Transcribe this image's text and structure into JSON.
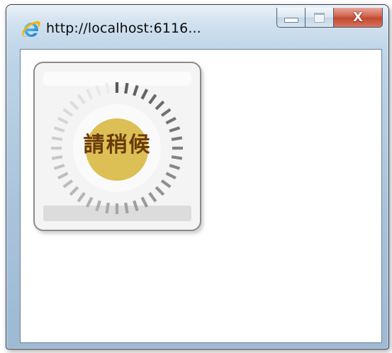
{
  "window": {
    "title": "http://localhost:6116...",
    "icon": "ie-icon",
    "close_glyph": "X"
  },
  "loader": {
    "message": "請稍候",
    "accent_color": "#dcc055",
    "text_color": "#6b3a0a",
    "tick_count": 40
  },
  "caption_buttons": [
    "minimize-button",
    "maximize-button",
    "close-button"
  ]
}
